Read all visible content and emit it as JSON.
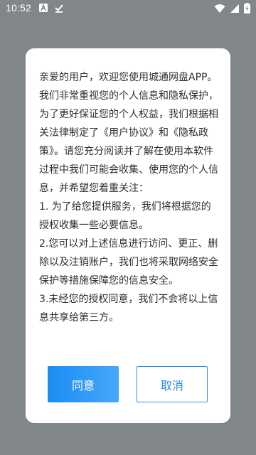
{
  "status_bar": {
    "time": "10:52",
    "left_icons": [
      "app-a-icon",
      "download-complete-icon"
    ],
    "right_icons": [
      "wifi-icon",
      "cell-signal-icon",
      "battery-charging-icon"
    ]
  },
  "dialog": {
    "paragraphs": [
      "亲爱的用户，欢迎您使用城通网盘APP。",
      "我们非常重视您的个人信息和隐私保护，为了更好保证您的个人权益，我们根据相关法律制定了《用户协议》和《隐私政策》。请您充分阅读并了解在使用本软件过程中我们可能会收集、使用您的个人信息，并希望您着重关注：",
      "1. 为了给您提供服务，我们将根据您的授权收集一些必要信息。",
      "2.您可以对上述信息进行访问、更正、删除以及注销账户，我们也将采取网络安全保护等措施保障您的信息安全。",
      "3.未经您的授权同意，我们不会将以上信息共享给第三方。"
    ],
    "agree_label": "同意",
    "cancel_label": "取消"
  },
  "colors": {
    "overlay": "#818788",
    "accent": "#2c8dec",
    "agree_gradient_start": "#1c8bf2",
    "agree_gradient_end": "#45a9fb",
    "text": "#2e2e2e"
  }
}
